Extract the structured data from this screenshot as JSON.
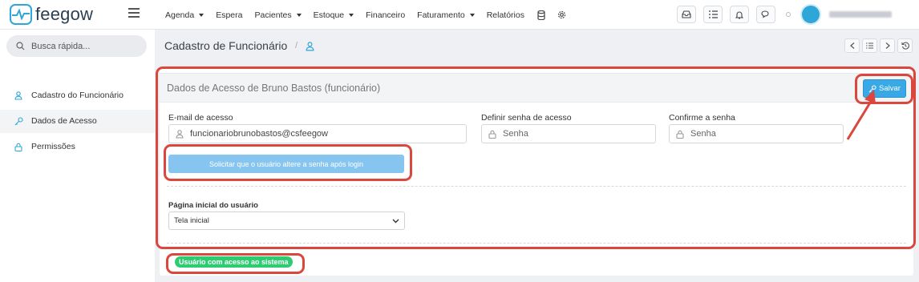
{
  "brand": {
    "name": "feegow",
    "color": "#2fa6d8"
  },
  "nav": {
    "items": [
      {
        "label": "Agenda",
        "dropdown": true
      },
      {
        "label": "Espera",
        "dropdown": false
      },
      {
        "label": "Pacientes",
        "dropdown": true
      },
      {
        "label": "Estoque",
        "dropdown": true
      },
      {
        "label": "Financeiro",
        "dropdown": false
      },
      {
        "label": "Faturamento",
        "dropdown": true
      },
      {
        "label": "Relatórios",
        "dropdown": false
      }
    ],
    "icons": [
      "database-icon",
      "gear-icon"
    ]
  },
  "top_actions": [
    "inbox-icon",
    "checklist-icon",
    "bell-icon",
    "chat-icon"
  ],
  "sidebar": {
    "search_placeholder": "Busca rápida...",
    "items": [
      {
        "label": "Cadastro do Funcionário",
        "icon": "user-icon"
      },
      {
        "label": "Dados de Acesso",
        "icon": "key-icon",
        "active": true
      },
      {
        "label": "Permissões",
        "icon": "lock-icon"
      }
    ]
  },
  "header": {
    "title": "Cadastro de Funcionário",
    "separator": "/"
  },
  "form": {
    "title": "Dados de Acesso de Bruno Bastos (funcionário)",
    "save_label": "Salvar",
    "email_label": "E-mail de acesso",
    "email_value": "funcionariobrunobastos@csfeegow",
    "password_label": "Definir senha de acesso",
    "password_placeholder": "Senha",
    "confirm_label": "Confirme a senha",
    "confirm_placeholder": "Senha",
    "request_button": "Solicitar que o usuário altere a senha após login",
    "home_label": "Página inicial do usuário",
    "home_value": "Tela inicial",
    "status_badge": "Usuário com acesso ao sistema"
  },
  "colors": {
    "accent": "#38a8e6",
    "annotation": "#d9473d",
    "success": "#2ecc71"
  }
}
